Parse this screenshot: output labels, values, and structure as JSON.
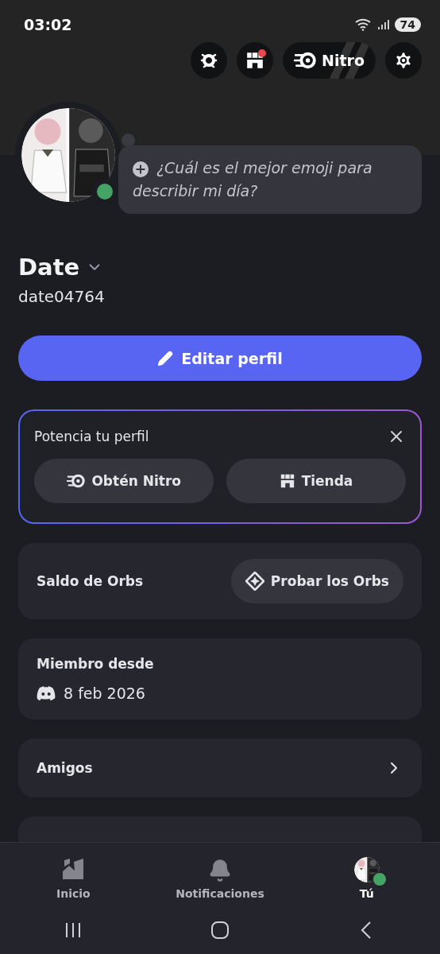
{
  "status_bar": {
    "time": "03:02",
    "battery": "74"
  },
  "header_buttons": [
    {
      "kind": "quests"
    },
    {
      "kind": "shop",
      "badge": true
    },
    {
      "kind": "nitro",
      "label": "Nitro"
    },
    {
      "kind": "settings"
    }
  ],
  "profile": {
    "online": true,
    "status_prompt": "¿Cuál es el mejor emoji para describir mi día?",
    "display_name": "Date",
    "username": "date04764"
  },
  "edit_button": "Editar perfil",
  "boost_card": {
    "title": "Potencia tu perfil",
    "buttons": [
      {
        "kind": "nitro",
        "label": "Obtén Nitro"
      },
      {
        "kind": "shop",
        "label": "Tienda"
      }
    ]
  },
  "orbs_card": {
    "label": "Saldo de Orbs",
    "button": "Probar los Orbs"
  },
  "member_card": {
    "title": "Miembro desde",
    "date": "8 feb 2026"
  },
  "friends_row": {
    "label": "Amigos"
  },
  "tabs": [
    {
      "kind": "home",
      "label": "Inicio",
      "selected": false
    },
    {
      "kind": "notifications",
      "label": "Notificaciones",
      "selected": false
    },
    {
      "kind": "you",
      "label": "Tú",
      "selected": true
    }
  ]
}
